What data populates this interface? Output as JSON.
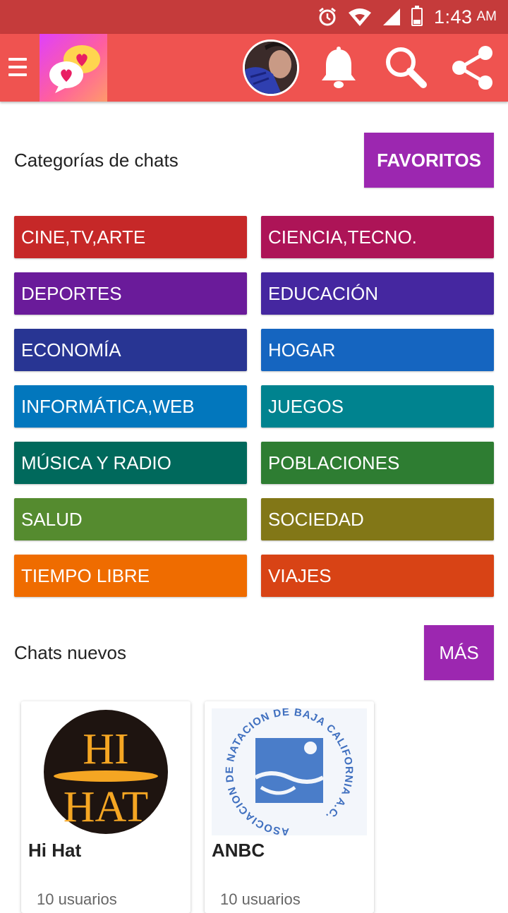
{
  "status_bar": {
    "time": "1:43",
    "ampm": "AM",
    "battery": "19"
  },
  "toolbar": {
    "menu_icon": "hamburger-menu-icon",
    "logo_icon": "chat-hearts-logo",
    "avatar": "user-avatar",
    "icons": [
      "bell-icon",
      "search-icon",
      "share-icon"
    ],
    "color": "#ef5350"
  },
  "categories_section": {
    "title": "Categorías de chats",
    "favorites_label": "FAVORITOS",
    "items": [
      {
        "label": "CINE,TV,ARTE",
        "color": "#c62828"
      },
      {
        "label": "CIENCIA,TECNO.",
        "color": "#ad1457"
      },
      {
        "label": "DEPORTES",
        "color": "#6a1b9a"
      },
      {
        "label": "EDUCACIÓN",
        "color": "#4527a0"
      },
      {
        "label": "ECONOMÍA",
        "color": "#283593"
      },
      {
        "label": "HOGAR",
        "color": "#1565c0"
      },
      {
        "label": "INFORMÁTICA,WEB",
        "color": "#0277bd"
      },
      {
        "label": "JUEGOS",
        "color": "#00838f"
      },
      {
        "label": "MÚSICA Y RADIO",
        "color": "#00695c"
      },
      {
        "label": "POBLACIONES",
        "color": "#2e7d32"
      },
      {
        "label": "SALUD",
        "color": "#558b2f"
      },
      {
        "label": "SOCIEDAD",
        "color": "#827717"
      },
      {
        "label": "TIEMPO LIBRE",
        "color": "#ef6c00"
      },
      {
        "label": "VIAJES",
        "color": "#d84315"
      }
    ]
  },
  "new_chats_section": {
    "title": "Chats nuevos",
    "more_label": "MÁS",
    "cards": [
      {
        "name": "Hi Hat",
        "meta": "10 usuarios",
        "logo_text_top": "HI",
        "logo_text_bottom": "HAT"
      },
      {
        "name": "ANBC",
        "meta": "10 usuarios",
        "logo_ring_text": "ASOCIACION DE NATACION DE BAJA CALIFORNIA A.C."
      }
    ]
  },
  "accent_color": "#9c27b0"
}
